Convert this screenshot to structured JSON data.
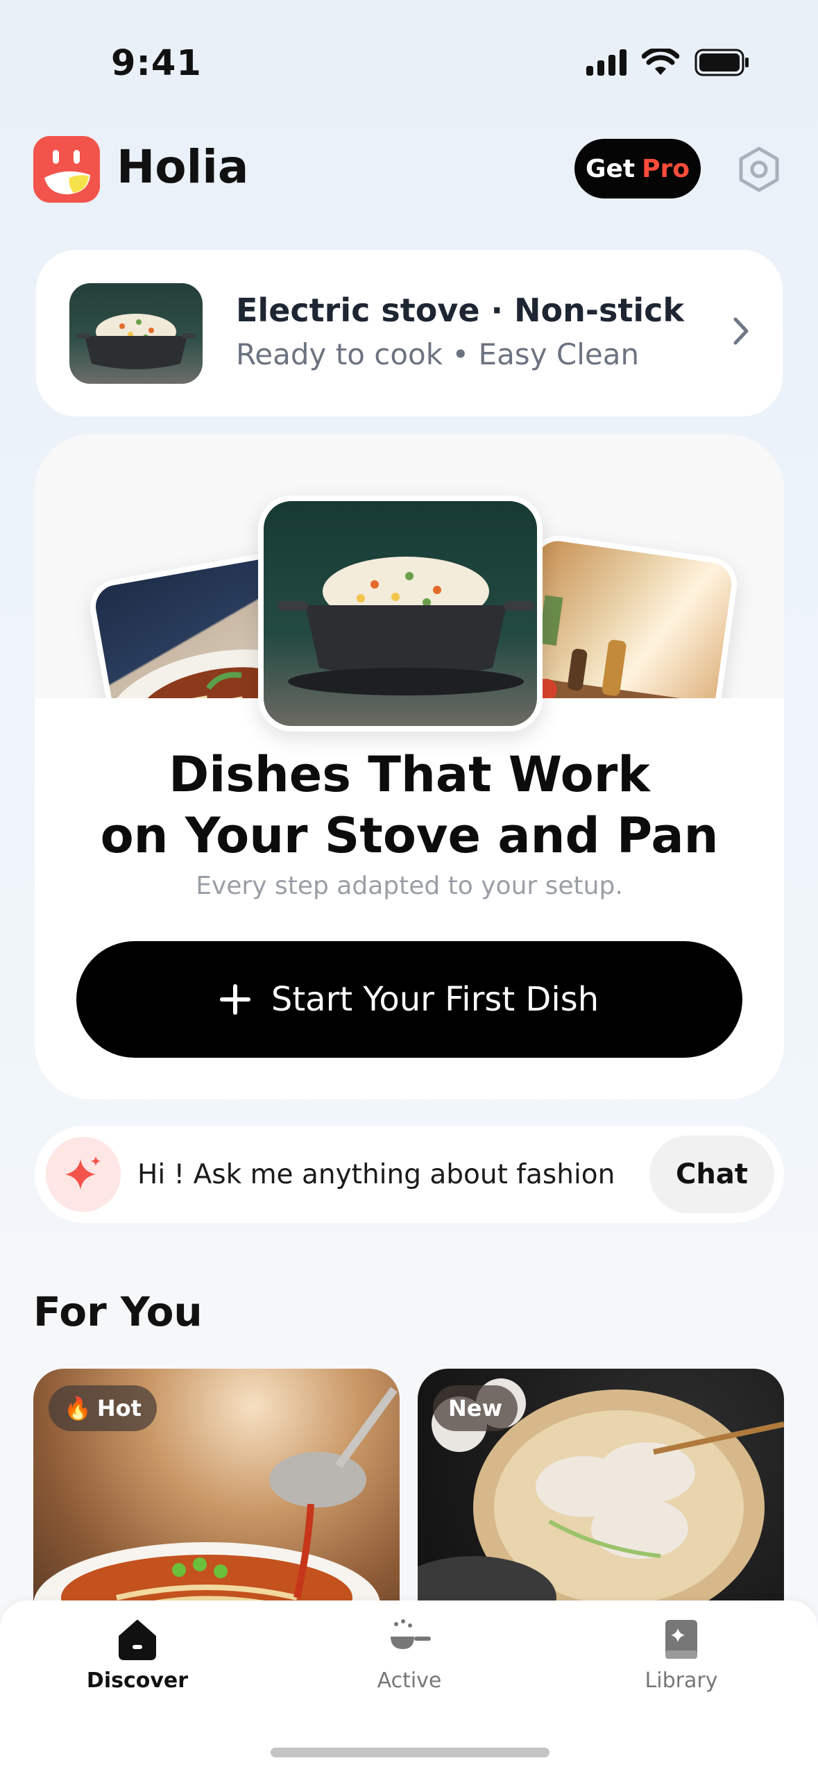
{
  "status_bar": {
    "time": "9:41"
  },
  "header": {
    "app_name": "Holia",
    "get_label": "Get",
    "pro_label": "Pro"
  },
  "setup_card": {
    "title": "Electric stove · Non-stick",
    "subtitle": "Ready to cook • Easy Clean"
  },
  "hero": {
    "title_line1": "Dishes That Work",
    "title_line2": "on Your Stove and Pan",
    "subtitle": "Every step adapted to your setup.",
    "cta_label": "Start Your First Dish"
  },
  "assistant": {
    "prompt": "Hi ! Ask me anything about fashion",
    "chat_label": "Chat"
  },
  "for_you": {
    "title": "For You",
    "cards": [
      {
        "badge": "Hot",
        "badge_icon": "fire-icon"
      },
      {
        "badge": "New"
      }
    ]
  },
  "tabbar": {
    "items": [
      {
        "label": "Discover",
        "icon": "home-icon",
        "active": true
      },
      {
        "label": "Active",
        "icon": "pan-icon",
        "active": false
      },
      {
        "label": "Library",
        "icon": "book-icon",
        "active": false
      }
    ]
  },
  "colors": {
    "accent": "#f2534b",
    "pro": "#ff4c3b",
    "background": "#eaf1f9",
    "cta": "#000000"
  }
}
